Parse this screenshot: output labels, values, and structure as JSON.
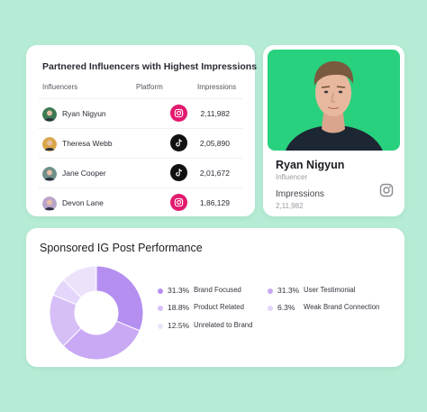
{
  "influencers_table": {
    "title": "Partnered Influencers with Highest Impressions",
    "columns": {
      "influencers": "Influencers",
      "platform": "Platform",
      "impressions": "Impressions"
    },
    "rows": [
      {
        "name": "Ryan Nigyun",
        "platform": "instagram-icon",
        "impressions": "2,11,982",
        "avatar_color": "#3d7a54"
      },
      {
        "name": "Theresa Webb",
        "platform": "tiktok-icon",
        "impressions": "2,05,890",
        "avatar_color": "#d9a74a"
      },
      {
        "name": "Jane Cooper",
        "platform": "tiktok-icon",
        "impressions": "2,01,672",
        "avatar_color": "#6f8f8a"
      },
      {
        "name": "Devon Lane",
        "platform": "instagram-icon",
        "impressions": "1,86,129",
        "avatar_color": "#b9a4c9"
      }
    ]
  },
  "profile": {
    "name": "Ryan Nigyun",
    "role": "Influencer",
    "impressions_label": "Impressions",
    "impressions_value": "2,11,982",
    "photo_bg": "#28d17d",
    "platform_icon": "instagram-icon"
  },
  "chart": {
    "title": "Sponsored IG Post Performance"
  },
  "chart_data": {
    "type": "pie",
    "title": "Sponsored IG Post Performance",
    "slices": [
      {
        "label": "Brand Focused",
        "value": 31.3,
        "display": "31.3%",
        "color": "#b48ff0"
      },
      {
        "label": "User Testimonial",
        "value": 31.3,
        "display": "31.3%",
        "color": "#c9a8f4"
      },
      {
        "label": "Product Related",
        "value": 18.8,
        "display": "18.8%",
        "color": "#d6bff7"
      },
      {
        "label": "Weak Brand Connection",
        "value": 6.3,
        "display": "6.3%",
        "color": "#e4d6fa"
      },
      {
        "label": "Unrelated to Brand",
        "value": 12.5,
        "display": "12.5%",
        "color": "#ece3fb"
      }
    ],
    "legend_placement": "right"
  },
  "colors": {
    "background": "#b6ecd5",
    "instagram": "#e2196e",
    "tiktok": "#111111"
  }
}
